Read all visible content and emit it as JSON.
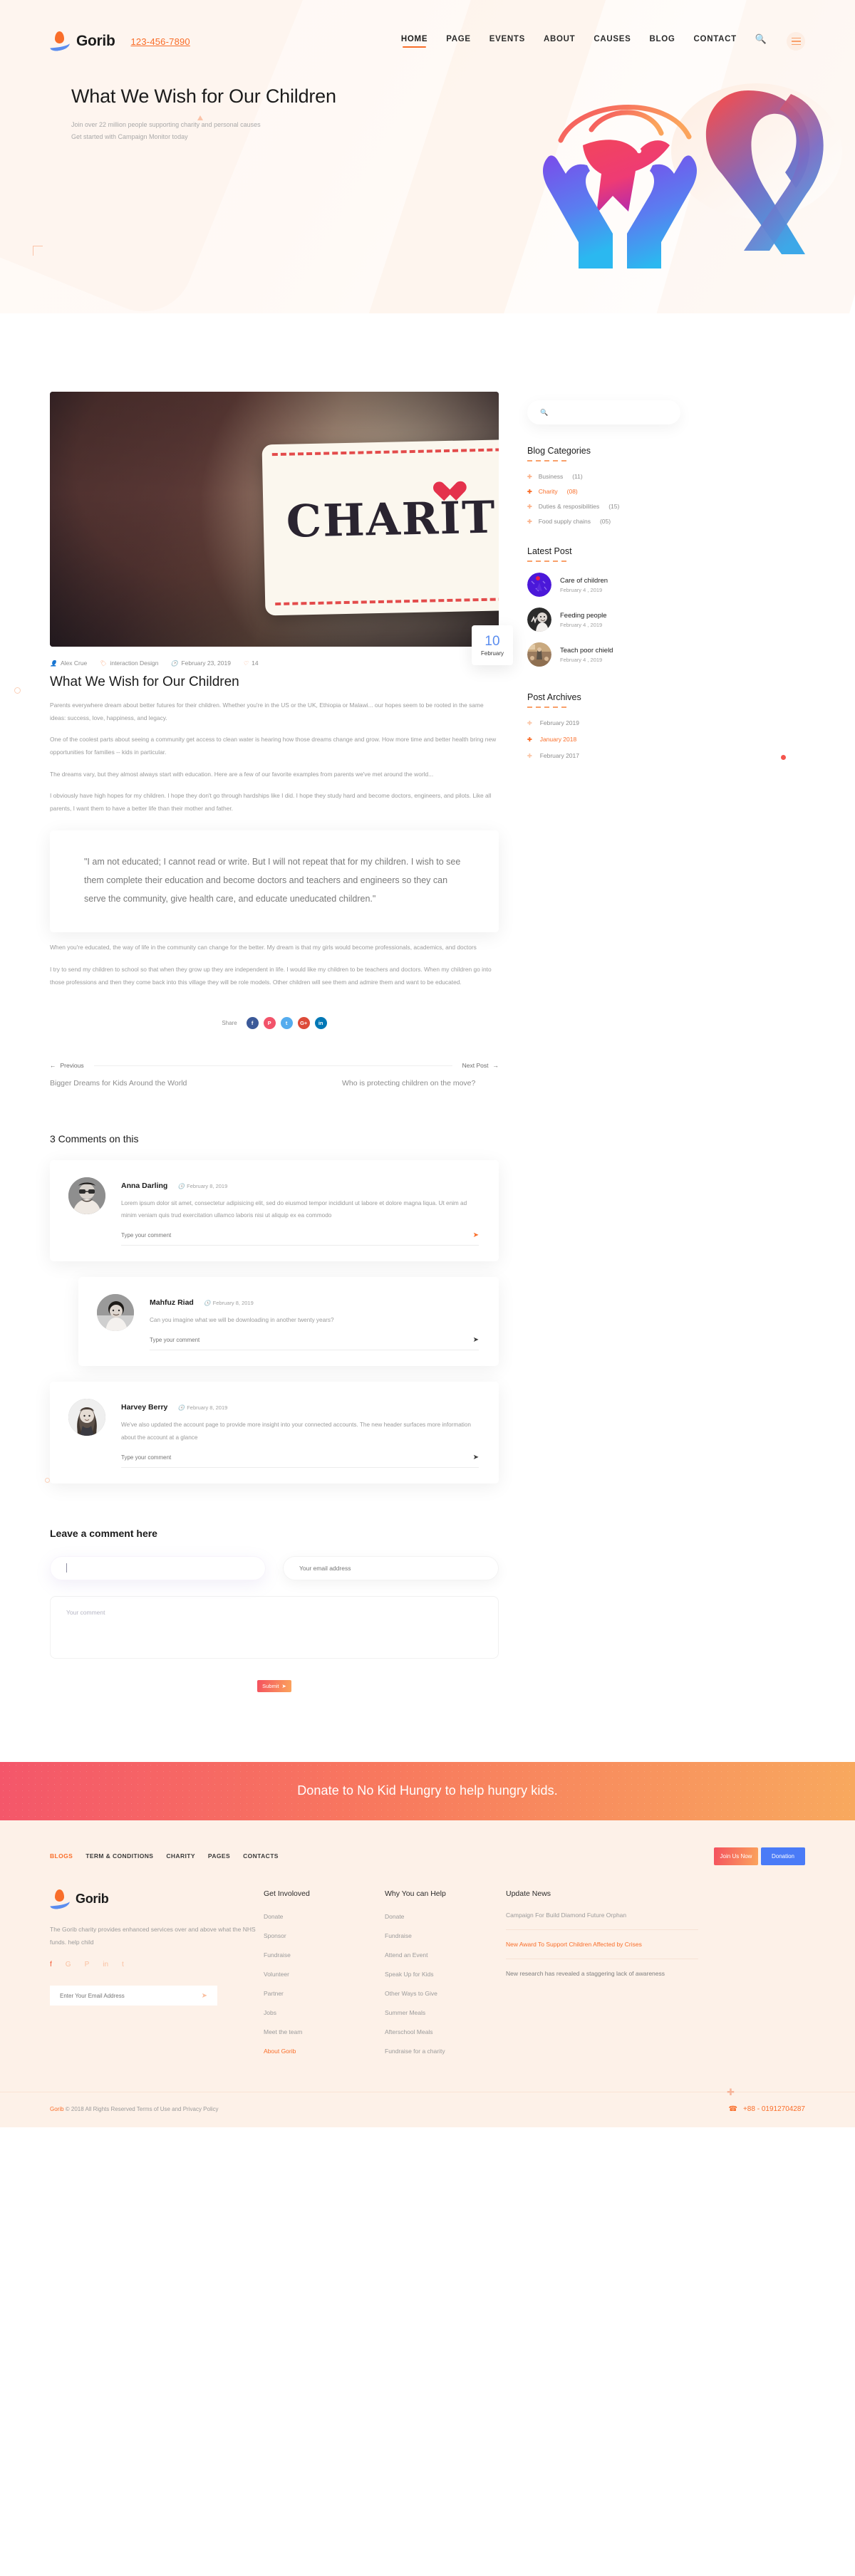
{
  "header": {
    "brand": "Gorib",
    "phone": "123-456-7890",
    "menu": [
      {
        "label": "HOME",
        "active": true
      },
      {
        "label": "PAGE",
        "active": false
      },
      {
        "label": "EVENTS",
        "active": false
      },
      {
        "label": "ABOUT",
        "active": false
      },
      {
        "label": "CAUSES",
        "active": false
      },
      {
        "label": "BLOG",
        "active": false
      },
      {
        "label": "CONTACT",
        "active": false
      }
    ],
    "search_icon": "search-icon",
    "menu_icon": "hamburger-icon"
  },
  "hero": {
    "title": "What We Wish for Our Children",
    "sub1": "Join over 22 million people supporting charity and personal causes",
    "sub2": "Get started with Campaign Monitor today"
  },
  "post": {
    "date_day": "10",
    "date_month": "February",
    "image_text": "CHARIT",
    "meta": {
      "author": "Alex Crue",
      "category": "interaction Design",
      "date": "February 23, 2019",
      "likes": "14"
    },
    "title": "What We Wish for Our Children",
    "paragraphs": [
      "Parents everywhere dream about better futures for their children. Whether you're in the US or the UK, Ethiopia or Malawi... our hopes seem to be rooted in the same ideas: success, love, happiness, and legacy.",
      "One of the coolest parts about seeing a community get access to clean water is hearing how those dreams change and grow. How more time and better health bring new opportunities for families -- kids in particular.",
      "The dreams vary, but they almost always start with education. Here are a few of our favorite examples from parents we've met around the world...",
      "I obviously have high hopes for my children. I hope they don't go through hardships like I did. I hope they study hard and become doctors, engineers, and pilots. Like all parents, I want them to have a better life than their mother and father."
    ],
    "quote": "\"I am not educated; I cannot read or write. But I will not repeat that for my children. I wish to see them complete their education and become doctors and teachers and engineers so they can serve the community, give health care, and educate uneducated children.\"",
    "paragraphs_after": [
      "When you're educated, the way of life in the community can change for the better. My dream is that my girls would become professionals, academics, and doctors",
      "I try to send my children to school so that when they grow up they are independent in life. I would like my children to be teachers and doctors. When my children go into those professions and then they come back into this village they will be role models. Other children will see them and admire them and want to be educated."
    ],
    "share_label": "Share",
    "share": [
      {
        "name": "facebook-icon",
        "glyph": "f"
      },
      {
        "name": "pinterest-icon",
        "glyph": "P"
      },
      {
        "name": "twitter-icon",
        "glyph": "t"
      },
      {
        "name": "google-plus-icon",
        "glyph": "G+"
      },
      {
        "name": "linkedin-icon",
        "glyph": "in"
      }
    ]
  },
  "pagination": {
    "prev_label": "Previous",
    "next_label": "Next Post",
    "prev_title": "Bigger Dreams for Kids Around the World",
    "next_title": "Who is protecting children on the move?"
  },
  "comments": {
    "heading": "3 Comments on this",
    "reply_placeholder": "Type your comment",
    "items": [
      {
        "name": "Anna Darling",
        "date": "February 8, 2019",
        "text": "Lorem ipsum dolor sit amet, consectetur adipisicing elit, sed do eiusmod tempor incididunt ut labore et dolore magna liqua. Ut enim ad minim veniam quis trud exercitation ullamco laboris nisi ut aliquip ex ea commodo",
        "indent": false,
        "send_accent": true
      },
      {
        "name": "Mahfuz Riad",
        "date": "February 8, 2019",
        "text": "Can you imagine what we will be downloading in another twenty years?",
        "indent": true,
        "send_accent": false
      },
      {
        "name": "Harvey Berry",
        "date": "February 8, 2019",
        "text": "We've also updated the account page to provide more insight into your connected accounts. The new header surfaces more information about the account at a glance",
        "indent": false,
        "send_accent": false
      }
    ]
  },
  "leave_comment": {
    "heading": "Leave a comment here",
    "name_value": "",
    "name_placeholder": "",
    "email_placeholder": "Your email address",
    "comment_placeholder": "Your comment",
    "submit_label": "Submit"
  },
  "sidebar": {
    "search_placeholder": "",
    "categories_heading": "Blog Categories",
    "categories": [
      {
        "label": "Business",
        "count": "(11)",
        "active": false
      },
      {
        "label": "Charity",
        "count": "(08)",
        "active": true
      },
      {
        "label": "Duties & resposibilities",
        "count": "(15)",
        "active": false
      },
      {
        "label": "Food supply chains",
        "count": "(05)",
        "active": false
      }
    ],
    "latest_heading": "Latest Post",
    "latest": [
      {
        "title": "Care of children",
        "date": "February 4 , 2019",
        "thumb": "purple"
      },
      {
        "title": "Feeding people",
        "date": "February 4 , 2019",
        "thumb": "kids"
      },
      {
        "title": "Teach poor chield",
        "date": "February 4 , 2019",
        "thumb": "class"
      }
    ],
    "archives_heading": "Post Archives",
    "archives": [
      {
        "label": "February 2019",
        "active": false
      },
      {
        "label": "January 2018",
        "active": true
      },
      {
        "label": "February 2017",
        "active": false
      }
    ]
  },
  "donate_banner": {
    "text": "Donate to No Kid Hungry to help hungry kids."
  },
  "footer": {
    "top_links": [
      {
        "label": "BLOGS",
        "active": true
      },
      {
        "label": "TERM & CONDITIONS",
        "active": false
      },
      {
        "label": "CHARITY",
        "active": false
      },
      {
        "label": "PAGES",
        "active": false
      },
      {
        "label": "CONTACTS",
        "active": false
      }
    ],
    "join_label": "Join Us Now",
    "donation_label": "Donation",
    "brand": "Gorib",
    "about": "The Gorib charity provides enhanced services over and above what the NHS funds. help child",
    "social": [
      {
        "name": "facebook-icon",
        "glyph": "f"
      },
      {
        "name": "google-icon",
        "glyph": "G"
      },
      {
        "name": "pinterest-icon",
        "glyph": "P"
      },
      {
        "name": "linkedin-icon",
        "glyph": "in"
      },
      {
        "name": "twitter-icon",
        "glyph": "t"
      }
    ],
    "newsletter_placeholder": "Enter Your Email Address",
    "col_get_involved": {
      "heading": "Get Involoved",
      "items": [
        {
          "label": "Donate",
          "active": false
        },
        {
          "label": "Sponsor",
          "active": false
        },
        {
          "label": "Fundraise",
          "active": false
        },
        {
          "label": "Volunteer",
          "active": false
        },
        {
          "label": "Partner",
          "active": false
        },
        {
          "label": "Jobs",
          "active": false
        },
        {
          "label": "Meet the team",
          "active": false
        },
        {
          "label": "About Gorib",
          "active": true
        }
      ]
    },
    "col_why_help": {
      "heading": "Why You can Help",
      "items": [
        {
          "label": "Donate",
          "active": false
        },
        {
          "label": "Fundraise",
          "active": false
        },
        {
          "label": "Attend an Event",
          "active": false
        },
        {
          "label": "Speak Up for Kids",
          "active": false
        },
        {
          "label": "Other Ways to Give",
          "active": false
        },
        {
          "label": "Summer Meals",
          "active": false
        },
        {
          "label": "Afterschool Meals",
          "active": false
        },
        {
          "label": "Fundraise for a charity",
          "active": false
        }
      ]
    },
    "col_update_news": {
      "heading": "Update News",
      "items": [
        {
          "text": "Campaign For Build Diamond Future Orphan",
          "accent": false,
          "last": false
        },
        {
          "text": "New Award To Support Children Affected by Crises",
          "accent": true,
          "last": false
        },
        {
          "text": "New research has revealed a staggering lack of awareness",
          "accent": false,
          "last": true
        }
      ]
    },
    "copyright_brand": "Gorib",
    "copyright": " © 2018 All Rights Reserved Terms of Use and Privacy Policy",
    "phone": "+88 - 01912704287"
  },
  "colors": {
    "accent": "#f96e2a",
    "accent_red": "#f4515f",
    "accent_orange": "#fba45c",
    "blue": "#4a7bf7",
    "footer_bg": "#fdf1e8"
  }
}
